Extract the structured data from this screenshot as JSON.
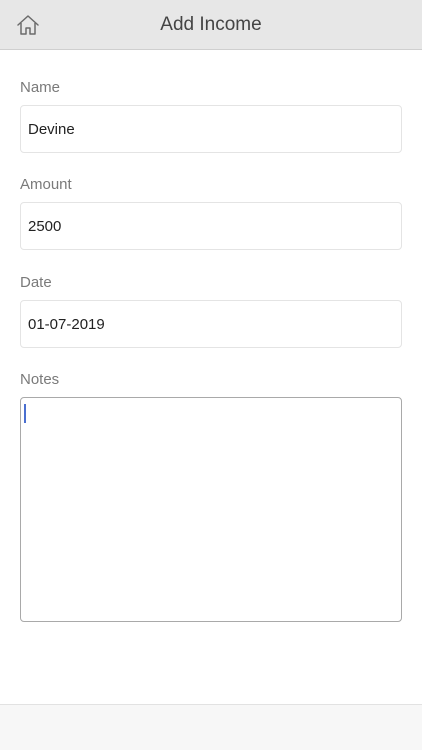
{
  "header": {
    "title": "Add Income",
    "home_icon": "home-icon"
  },
  "form": {
    "name": {
      "label": "Name",
      "value": "Devine"
    },
    "amount": {
      "label": "Amount",
      "value": "2500"
    },
    "date": {
      "label": "Date",
      "value": "01-07-2019"
    },
    "notes": {
      "label": "Notes",
      "value": ""
    }
  },
  "colors": {
    "header_bg": "#e7e7e7",
    "caret": "#4a6fd0"
  }
}
